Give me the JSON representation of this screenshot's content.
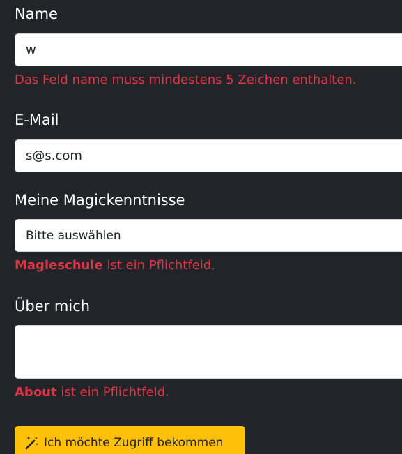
{
  "form": {
    "name": {
      "label": "Name",
      "value": "w",
      "error": "Das Feld name muss mindestens 5 Zeichen enthalten."
    },
    "email": {
      "label": "E-Mail",
      "value": "s@s.com"
    },
    "magic": {
      "label": "Meine Magickenntnisse",
      "selected": "Bitte auswählen",
      "error_field": "Magieschule",
      "error_text": " ist ein Pflichtfeld."
    },
    "about": {
      "label": "Über mich",
      "value": "",
      "error_field": "About",
      "error_text": " ist ein Pflichtfeld."
    },
    "submit": {
      "icon": "magic-wand-icon",
      "label": "Ich möchte Zugriff bekommen"
    }
  },
  "colors": {
    "background": "#212529",
    "error": "#dc3545",
    "button": "#ffc107"
  }
}
